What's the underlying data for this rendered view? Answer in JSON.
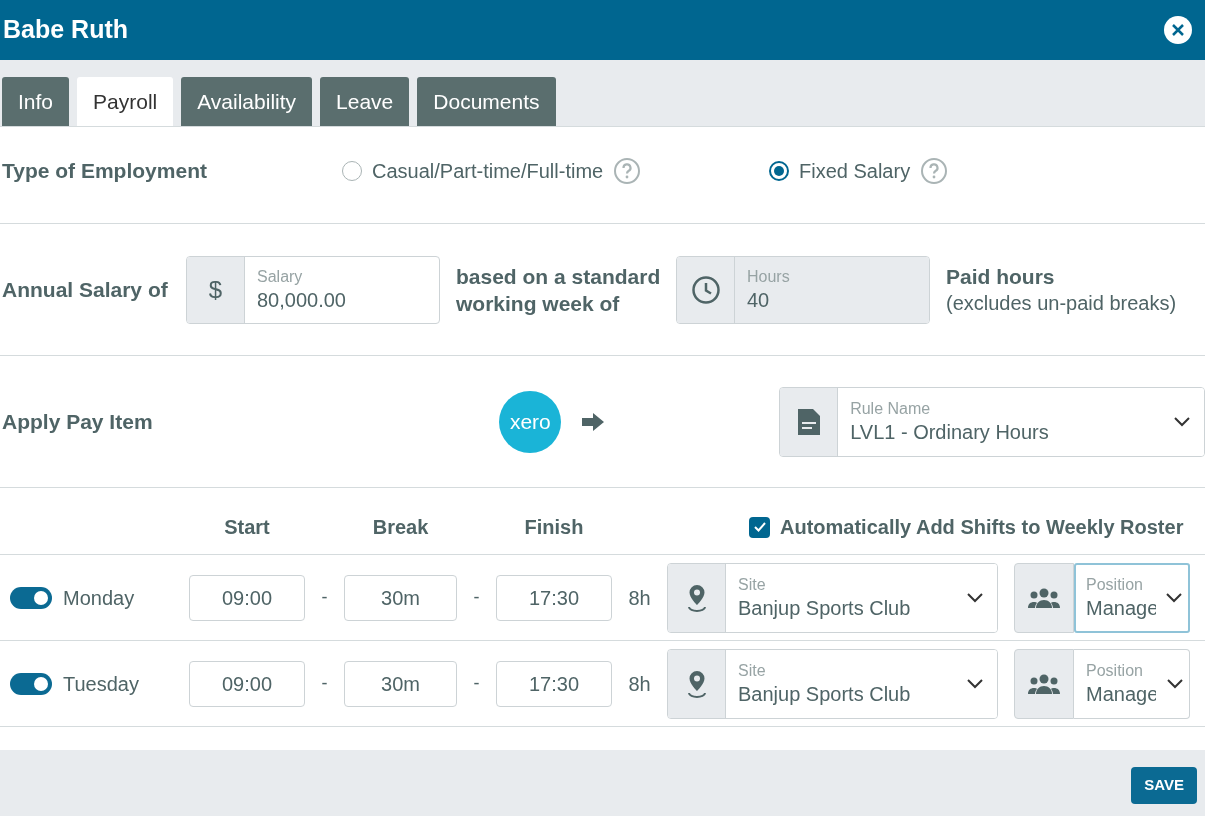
{
  "window": {
    "title": "Babe Ruth"
  },
  "tabs": [
    {
      "label": "Info",
      "selected": false
    },
    {
      "label": "Payroll",
      "selected": true
    },
    {
      "label": "Availability",
      "selected": false
    },
    {
      "label": "Leave",
      "selected": false
    },
    {
      "label": "Documents",
      "selected": false
    }
  ],
  "employment": {
    "label": "Type of Employment",
    "options": [
      {
        "label": "Casual/Part-time/Full-time",
        "selected": false
      },
      {
        "label": "Fixed Salary",
        "selected": true
      }
    ]
  },
  "salary": {
    "label": "Annual Salary of",
    "currency": "$",
    "field_label": "Salary",
    "value": "80,000.00",
    "middle_text": "based on a standard working week of",
    "hours_label": "Hours",
    "hours_value": "40",
    "paid_hours": "Paid hours",
    "note": "(excludes un-paid breaks)"
  },
  "pay_item": {
    "label": "Apply Pay Item",
    "logo_text": "xero",
    "rule_label": "Rule Name",
    "rule_value": "LVL1 - Ordinary Hours"
  },
  "schedule": {
    "columns": [
      "Start",
      "Break",
      "Finish"
    ],
    "auto_add": {
      "label": "Automatically Add Shifts to Weekly Roster",
      "checked": true
    },
    "days": [
      {
        "day": "Monday",
        "enabled": true,
        "start": "09:00",
        "break": "30m",
        "finish": "17:30",
        "hours": "8h",
        "separator": "-",
        "site_label": "Site",
        "site": "Banjup Sports Club",
        "position_label": "Position",
        "position": "Manage",
        "focused": true
      },
      {
        "day": "Tuesday",
        "enabled": true,
        "start": "09:00",
        "break": "30m",
        "finish": "17:30",
        "hours": "8h",
        "separator": "-",
        "site_label": "Site",
        "site": "Banjup Sports Club",
        "position_label": "Position",
        "position": "Manage",
        "focused": false
      }
    ]
  },
  "footer": {
    "save": "SAVE"
  }
}
